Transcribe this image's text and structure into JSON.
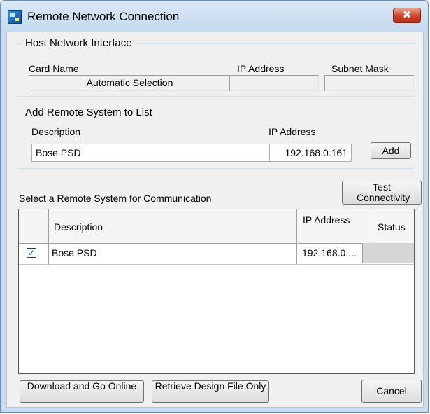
{
  "window": {
    "title": "Remote Network Connection",
    "close_glyph": "✖"
  },
  "host_interface": {
    "legend": "Host Network Interface",
    "card_name_label": "Card Name",
    "card_name_value": "Automatic Selection",
    "ip_label": "IP Address",
    "ip_value": "",
    "subnet_label": "Subnet Mask",
    "subnet_value": ""
  },
  "add_remote": {
    "legend": "Add Remote System to List",
    "description_label": "Description",
    "description_value": "Bose PSD",
    "ip_label": "IP Address",
    "ip_value": "192.168.0.161",
    "add_button": "Add"
  },
  "select_label": "Select a Remote System for Communication",
  "test_button": "Test Connectivity",
  "table": {
    "columns": [
      "",
      "Description",
      "IP Address",
      "Status"
    ],
    "rows": [
      {
        "checked": true,
        "description": "Bose PSD",
        "ip": "192.168.0....",
        "status": ""
      }
    ]
  },
  "footer": {
    "download_button": "Download and Go Online",
    "retrieve_button": "Retrieve Design File Only",
    "cancel_button": "Cancel"
  },
  "colors": {
    "title_bg": "#c9dcef",
    "close": "#c8442a",
    "client_bg": "#f0f0f0",
    "check": "#1a4fa0"
  }
}
